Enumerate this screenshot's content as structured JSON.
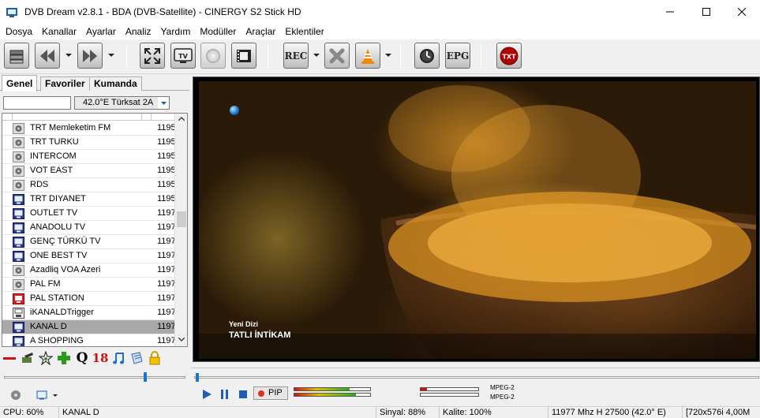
{
  "window": {
    "title": "DVB Dream v2.8.1 - BDA (DVB-Satellite)  -  CINERGY S2 Stick HD"
  },
  "menu": [
    "Dosya",
    "Kanallar",
    "Ayarlar",
    "Analiz",
    "Yardım",
    "Modüller",
    "Araçlar",
    "Eklentiler"
  ],
  "toolbar": {
    "rec_label": "REC",
    "tv_label": "TV",
    "epg_label": "EPG",
    "txt_label": "TXT"
  },
  "left_panel": {
    "tabs": [
      "Genel",
      "Favoriler",
      "Kumanda"
    ],
    "search": {
      "value": "",
      "placeholder": ""
    },
    "satellite": "42.0°E Türksat 2A"
  },
  "channels": [
    {
      "name": "TRT Memleketim FM",
      "freq": "1195",
      "type": "radio"
    },
    {
      "name": "TRT TURKU",
      "freq": "1195",
      "type": "radio"
    },
    {
      "name": "INTERCOM",
      "freq": "1195",
      "type": "radio"
    },
    {
      "name": "VOT EAST",
      "freq": "1195",
      "type": "radio"
    },
    {
      "name": "RDS",
      "freq": "1195",
      "type": "radio"
    },
    {
      "name": "TRT DIYANET",
      "freq": "1195",
      "type": "tv"
    },
    {
      "name": "OUTLET TV",
      "freq": "1197",
      "type": "tv"
    },
    {
      "name": "ANADOLU TV",
      "freq": "1197",
      "type": "tv"
    },
    {
      "name": "GENÇ TÜRKÜ TV",
      "freq": "1197",
      "type": "tv"
    },
    {
      "name": "ONE BEST TV",
      "freq": "1197",
      "type": "tv"
    },
    {
      "name": "Azadliq VOA Azeri",
      "freq": "1197",
      "type": "radio"
    },
    {
      "name": "PAL FM",
      "freq": "1197",
      "type": "radio"
    },
    {
      "name": "PAL STATION",
      "freq": "1197",
      "type": "tv-red"
    },
    {
      "name": "iKANALDTrigger",
      "freq": "1197",
      "type": "data"
    },
    {
      "name": "KANAL D",
      "freq": "1197",
      "type": "tv",
      "selected": true
    },
    {
      "name": "A SHOPPING",
      "freq": "1197",
      "type": "tv"
    }
  ],
  "channel_tools": {
    "q_label": "Q",
    "age_label": "18"
  },
  "video": {
    "caption_small": "Yeni Dizi",
    "caption_large": "TATLI İNTİKAM"
  },
  "player": {
    "pip_label": "PIP",
    "seek_position": 0.0,
    "video_codec": "MPEG-2",
    "audio_codec": "MPEG-2"
  },
  "status": {
    "cpu": "CPU: 60%",
    "channel": "KANAL D",
    "signal": "Sinyal: 88%",
    "quality": "Kalite: 100%",
    "tuning": "11977 Mhz  H  27500  (42.0° E)",
    "resolution": "[720x576i  4,00M"
  },
  "colors": {
    "accent": "#1e72c8",
    "selected_row": "#a9a9a9",
    "record": "#e0301e"
  }
}
